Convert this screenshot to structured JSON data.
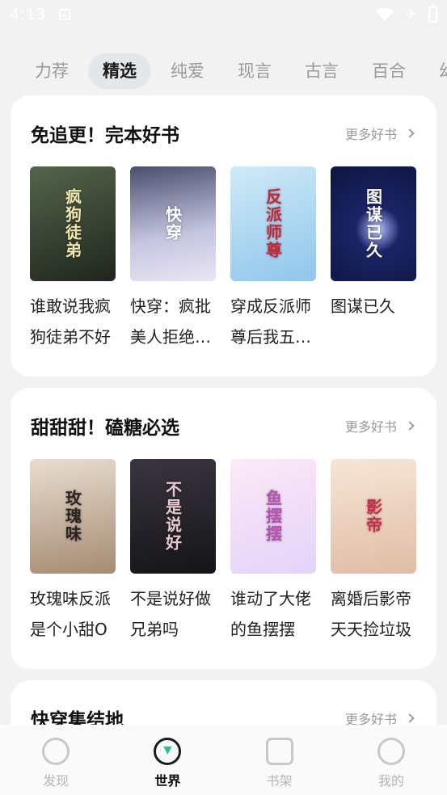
{
  "status_bar": {
    "time": "4:13"
  },
  "tabs": [
    "力荐",
    "精选",
    "纯爱",
    "现言",
    "古言",
    "百合",
    "幻"
  ],
  "active_tab": 1,
  "sections": [
    {
      "title": "免追更！完本好书",
      "more": "更多好书",
      "books": [
        {
          "title": "谁敢说我疯狗徒弟不好",
          "cover_text": "疯狗徒弟",
          "cover_bg": "#2e3a2c",
          "cover_fg": "#f2e6b0"
        },
        {
          "title": "快穿：疯批美人拒绝服从",
          "cover_text": "快穿",
          "cover_bg": "#8f8fb0",
          "cover_fg": "#ffffff"
        },
        {
          "title": "穿成反派师尊后我五杀逆徒",
          "cover_text": "反派师尊",
          "cover_bg": "#9fd2f0",
          "cover_fg": "#c2283a"
        },
        {
          "title": "图谋已久",
          "cover_text": "图谋已久",
          "cover_bg": "#1b2566",
          "cover_fg": "#ffffff"
        }
      ]
    },
    {
      "title": "甜甜甜！磕糖必选",
      "more": "更多好书",
      "books": [
        {
          "title": "玫瑰味反派是个小甜O",
          "cover_text": "玫瑰味",
          "cover_bg": "#c9b29c",
          "cover_fg": "#2b2420"
        },
        {
          "title": "不是说好做兄弟吗",
          "cover_text": "不是说好",
          "cover_bg": "#2a2a33",
          "cover_fg": "#e8c8d0"
        },
        {
          "title": "谁动了大佬的鱼摆摆",
          "cover_text": "鱼摆摆",
          "cover_bg": "#f4dff2",
          "cover_fg": "#b84fb2"
        },
        {
          "title": "离婚后影帝天天捡垃圾",
          "cover_text": "影帝",
          "cover_bg": "#f1d9c4",
          "cover_fg": "#c82e4a"
        }
      ]
    },
    {
      "title": "快穿集结地",
      "more": "更多好书"
    }
  ],
  "bottom_nav": [
    {
      "label": "发现",
      "icon": "discover-icon",
      "active": false
    },
    {
      "label": "世界",
      "icon": "world-icon",
      "active": true
    },
    {
      "label": "书架",
      "icon": "bookshelf-icon",
      "active": false
    },
    {
      "label": "我的",
      "icon": "profile-icon",
      "active": false
    }
  ]
}
